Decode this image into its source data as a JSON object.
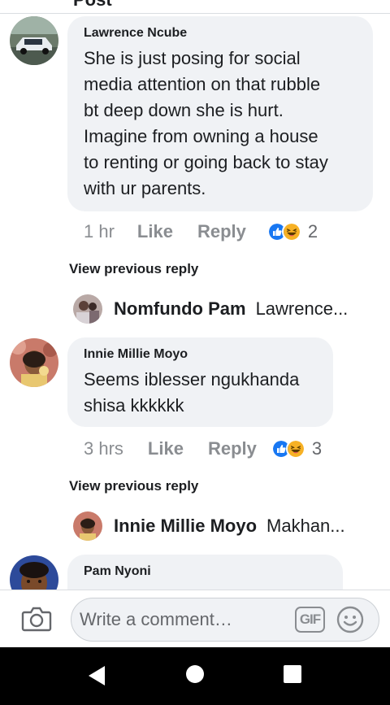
{
  "header": {
    "title_fragment": "Post"
  },
  "comments": [
    {
      "author": "Lawrence Ncube",
      "lines": [
        "She is just posing for social",
        "media attention on that  rubble",
        "bt deep down she is hurt.",
        "Imagine  from owning a  house",
        "to renting or going back to stay",
        "with ur parents."
      ],
      "time": "1 hr",
      "like": "Like",
      "reply": "Reply",
      "reaction_count": "2",
      "view_previous": "View previous reply",
      "reply_preview": {
        "name": "Nomfundo Pam",
        "text": "Lawrence..."
      }
    },
    {
      "author": "Innie Millie Moyo",
      "lines": [
        "Seems iblesser ngukhanda",
        "shisa kkkkkk"
      ],
      "time": "3 hrs",
      "like": "Like",
      "reply": "Reply",
      "reaction_count": "3",
      "view_previous": "View previous reply",
      "reply_preview": {
        "name": "Innie Millie Moyo",
        "text": "Makhan..."
      }
    },
    {
      "author": "Pam Nyoni"
    }
  ],
  "composer": {
    "placeholder": "Write a comment…",
    "gif_label": "GIF"
  },
  "icons": {
    "camera": "camera-icon",
    "gif": "gif-icon",
    "emoji": "emoji-icon",
    "like_reaction": "like-reaction-icon",
    "haha_reaction": "haha-reaction-icon",
    "back": "back-icon",
    "home": "home-icon",
    "recents": "recents-icon"
  },
  "colors": {
    "bubble": "#f0f2f5",
    "like_blue": "#1877f2",
    "haha_yellow": "#f7b125",
    "muted_text": "#8a8d91",
    "navbar": "#000000"
  }
}
